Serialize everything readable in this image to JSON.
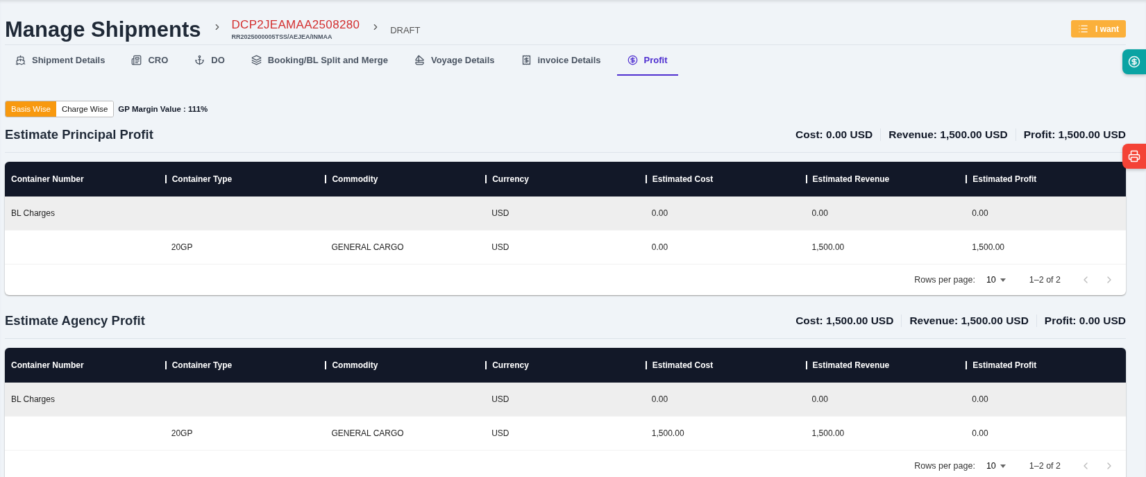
{
  "header": {
    "title": "Manage Shipments",
    "shipment_id": "DCP2JEAMAA2508280",
    "route": "RR2025000005TSS/AEJEA/INMAA",
    "status": "DRAFT",
    "action_button": "I want"
  },
  "tabs": [
    {
      "label": "Shipment Details",
      "kind": "ship",
      "selected": false
    },
    {
      "label": "CRO",
      "kind": "list",
      "selected": false
    },
    {
      "label": "DO",
      "kind": "anchor",
      "selected": false
    },
    {
      "label": "Booking/BL Split and Merge",
      "kind": "layers",
      "selected": false
    },
    {
      "label": "Voyage Details",
      "kind": "sail",
      "selected": false
    },
    {
      "label": "invoice Details",
      "kind": "receipt",
      "selected": false
    },
    {
      "label": "Profit",
      "kind": "dollar",
      "selected": true
    }
  ],
  "view_toggle": [
    {
      "label": "Basis Wise",
      "selected": true
    },
    {
      "label": "Charge Wise",
      "selected": false
    }
  ],
  "gp_margin": "GP Margin Value : 111%",
  "sections": [
    {
      "title": "Estimate Principal Profit",
      "totals": [
        "Cost: 0.00 USD",
        "Revenue: 1,500.00 USD",
        "Profit: 1,500.00 USD"
      ],
      "columns": [
        "Container Number",
        "Container Type",
        "Commodity",
        "Currency",
        "Estimated Cost",
        "Estimated Revenue",
        "Estimated Profit"
      ],
      "rows": [
        {
          "kind": "charge",
          "cells": [
            "BL Charges",
            "",
            "",
            "USD",
            "0.00",
            "0.00",
            "0.00"
          ]
        },
        {
          "kind": "item",
          "cells": [
            "",
            "20GP",
            "GENERAL CARGO",
            "USD",
            "0.00",
            "1,500.00",
            "1,500.00"
          ]
        }
      ],
      "pagination": {
        "label": "Rows per page:",
        "rows_per_page": "10",
        "range": "1–2 of 2"
      }
    },
    {
      "title": "Estimate Agency Profit",
      "totals": [
        "Cost: 1,500.00 USD",
        "Revenue: 1,500.00 USD",
        "Profit: 0.00 USD"
      ],
      "columns": [
        "Container Number",
        "Container Type",
        "Commodity",
        "Currency",
        "Estimated Cost",
        "Estimated Revenue",
        "Estimated Profit"
      ],
      "rows": [
        {
          "kind": "charge",
          "cells": [
            "BL Charges",
            "",
            "",
            "USD",
            "0.00",
            "0.00",
            "0.00"
          ]
        },
        {
          "kind": "item",
          "cells": [
            "",
            "20GP",
            "GENERAL CARGO",
            "USD",
            "1,500.00",
            "1,500.00",
            "0.00"
          ]
        }
      ],
      "pagination": {
        "label": "Rows per page:",
        "rows_per_page": "10",
        "range": "1–2 of 2"
      }
    }
  ]
}
